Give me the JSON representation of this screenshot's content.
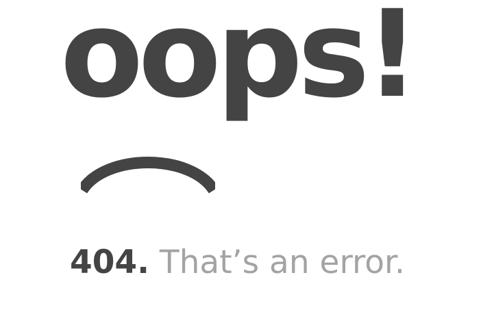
{
  "error_page": {
    "headline": "oops!",
    "error_code": "404.",
    "error_message": "That’s an error.",
    "graphic_icon": "frown-icon"
  },
  "colors": {
    "headline": "#444444",
    "code": "#444444",
    "message": "#a3a3a3",
    "background": "#ffffff"
  }
}
